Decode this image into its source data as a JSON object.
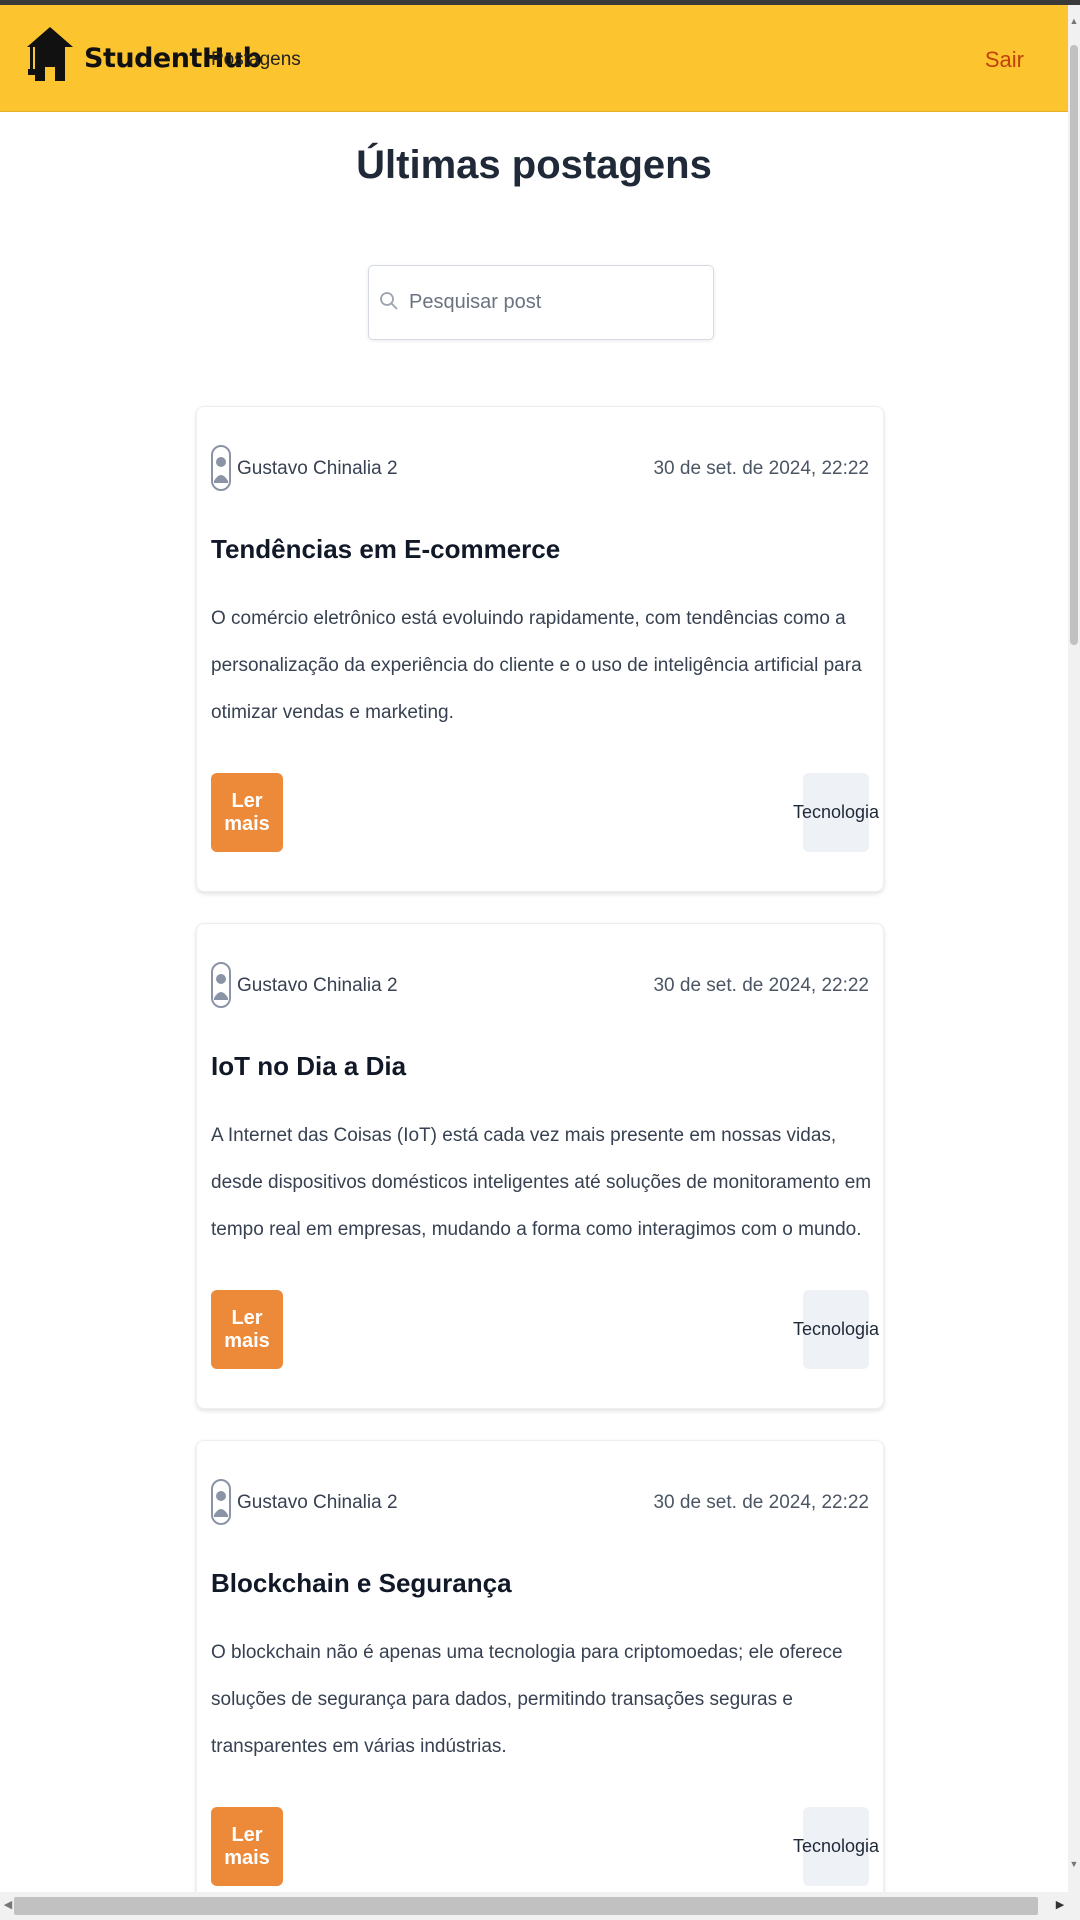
{
  "header": {
    "brand": "StudentHub",
    "nav_link": "Postagens",
    "logout": "Sair",
    "logo_icon": "graduation-cap-icon",
    "bg_color": "#fcc42e"
  },
  "main": {
    "title": "Últimas postagens",
    "search": {
      "placeholder": "Pesquisar post",
      "value": ""
    }
  },
  "posts": [
    {
      "author": "Gustavo Chinalia 2",
      "date": "30 de set. de 2024, 22:22",
      "title": "Tendências em E-commerce",
      "excerpt": "O comércio eletrônico está evoluindo rapidamente, com tendências como a personalização da experiência do cliente e o uso de inteligência artificial para otimizar vendas e marketing.",
      "button": "Ler mais",
      "category": "Tecnologia"
    },
    {
      "author": "Gustavo Chinalia 2",
      "date": "30 de set. de 2024, 22:22",
      "title": "IoT no Dia a Dia",
      "excerpt": "A Internet das Coisas (IoT) está cada vez mais presente em nossas vidas, desde dispositivos domésticos inteligentes até soluções de monitoramento em tempo real em empresas, mudando a forma como interagimos com o mundo.",
      "button": "Ler mais",
      "category": "Tecnologia"
    },
    {
      "author": "Gustavo Chinalia 2",
      "date": "30 de set. de 2024, 22:22",
      "title": "Blockchain e Segurança",
      "excerpt": "O blockchain não é apenas uma tecnologia para criptomoedas; ele oferece soluções de segurança para dados, permitindo transações seguras e transparentes em várias indústrias.",
      "button": "Ler mais",
      "category": "Tecnologia"
    }
  ],
  "colors": {
    "accent_button": "#ec8a3a",
    "logout_text": "#c2410c",
    "tag_bg": "#eef1f5"
  }
}
